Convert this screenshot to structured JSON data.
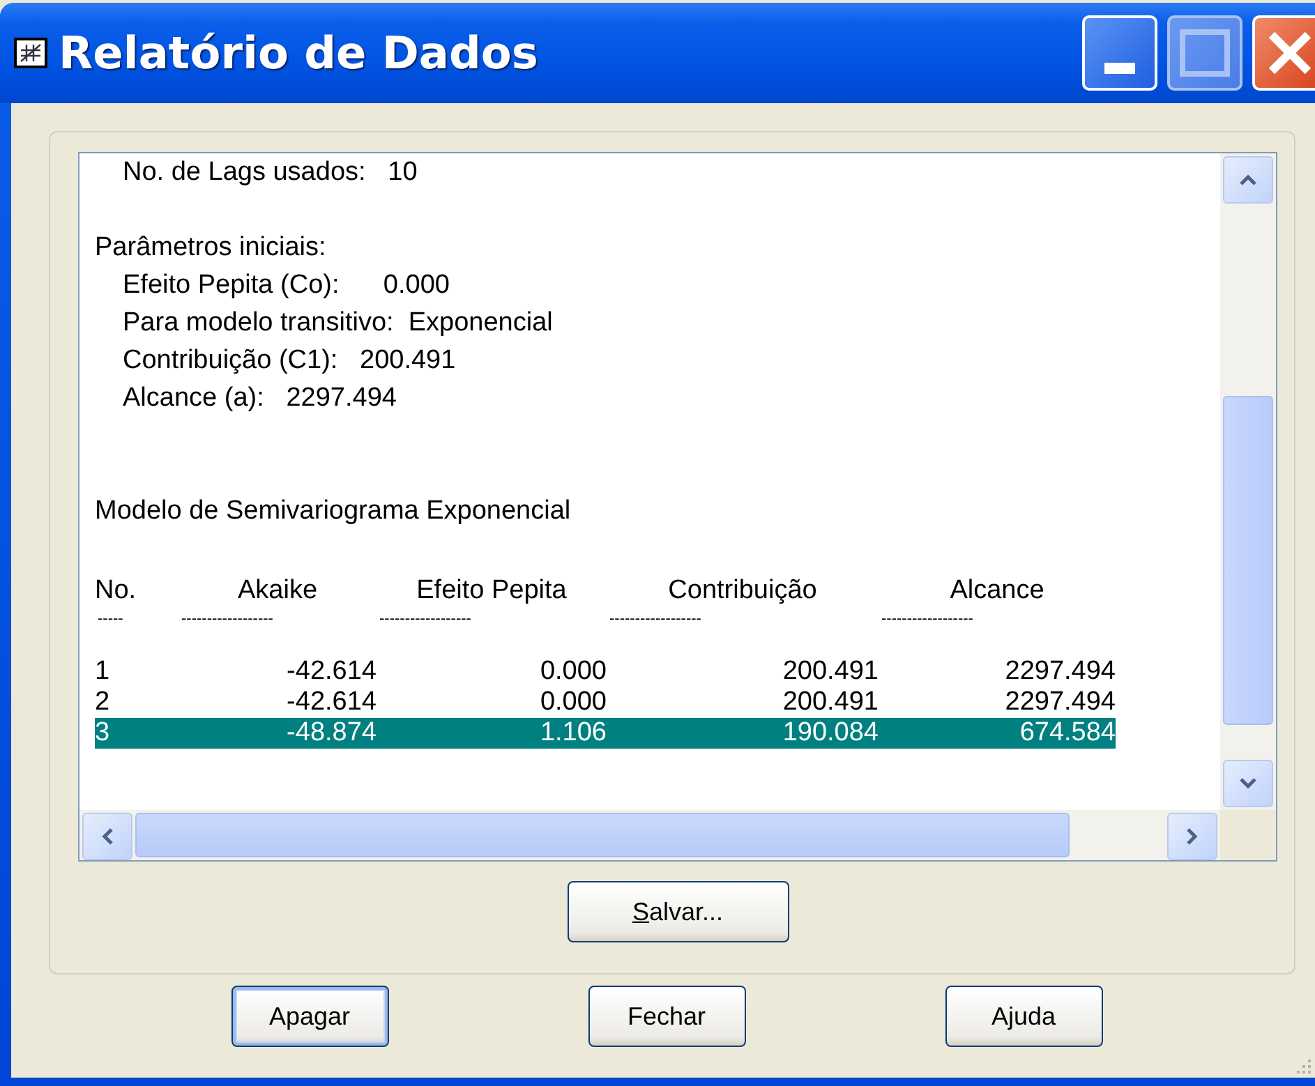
{
  "window": {
    "title": "Relatório de Dados",
    "controls": [
      {
        "kind": "minimize",
        "disabled": false
      },
      {
        "kind": "maximize",
        "disabled": true
      },
      {
        "kind": "close",
        "disabled": false
      }
    ]
  },
  "report": {
    "lines": [
      {
        "kind": "detail",
        "text": "No. de Lags usados:   10"
      },
      {
        "kind": "blank"
      },
      {
        "kind": "heading",
        "text": "Parâmetros iniciais:"
      },
      {
        "kind": "detail",
        "text": "Efeito Pepita (Co):      0.000"
      },
      {
        "kind": "detail",
        "text": "Para modelo transitivo:  Exponencial"
      },
      {
        "kind": "detail",
        "text": "Contribuição (C1):   200.491"
      },
      {
        "kind": "detail",
        "text": "Alcance (a):   2297.494"
      },
      {
        "kind": "blank"
      },
      {
        "kind": "blank"
      },
      {
        "kind": "heading",
        "text": "Modelo de Semivariograma Exponencial"
      },
      {
        "kind": "blank"
      }
    ],
    "table": {
      "columns": [
        {
          "label": "No.",
          "rule": "-----"
        },
        {
          "label": "Akaike",
          "rule": "------------------"
        },
        {
          "label": "Efeito Pepita",
          "rule": "------------------"
        },
        {
          "label": "Contribuição",
          "rule": "------------------"
        },
        {
          "label": "Alcance",
          "rule": "------------------"
        }
      ],
      "rows": [
        {
          "cells": [
            "1",
            "-42.614",
            "0.000",
            "200.491",
            "2297.494"
          ],
          "selected": false
        },
        {
          "cells": [
            "2",
            "-42.614",
            "0.000",
            "200.491",
            "2297.494"
          ],
          "selected": false
        },
        {
          "cells": [
            "3",
            "-48.874",
            "1.106",
            "190.084",
            "674.584"
          ],
          "selected": true
        }
      ]
    }
  },
  "save_button": {
    "access_key": "S",
    "rest": "alvar..."
  },
  "buttons": [
    {
      "label": "Apagar",
      "default": true
    },
    {
      "label": "Fechar",
      "default": false
    },
    {
      "label": "Ajuda",
      "default": false
    }
  ]
}
